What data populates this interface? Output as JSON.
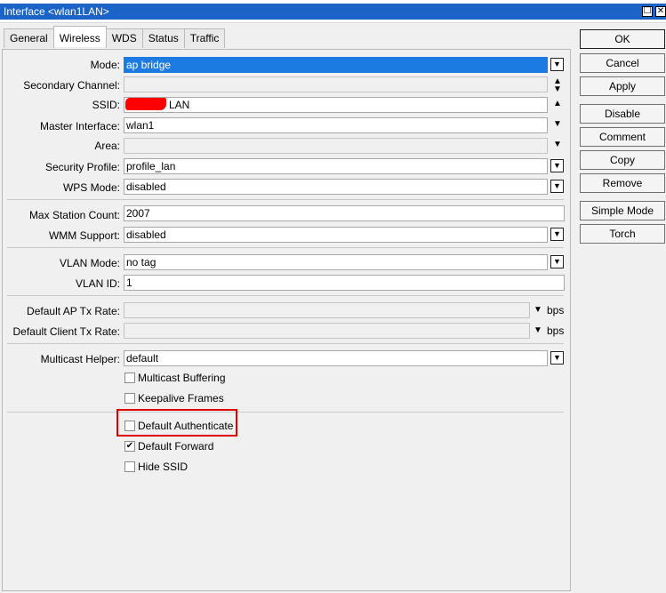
{
  "window": {
    "title": "Interface <wlan1LAN>",
    "maximize_glyph": "☐",
    "close_glyph": "✕"
  },
  "tabs": [
    {
      "label": "General"
    },
    {
      "label": "Wireless"
    },
    {
      "label": "WDS"
    },
    {
      "label": "Status"
    },
    {
      "label": "Traffic"
    }
  ],
  "form": {
    "mode": {
      "label": "Mode:",
      "value": "ap bridge"
    },
    "secondary_channel": {
      "label": "Secondary Channel:",
      "value": ""
    },
    "ssid": {
      "label": "SSID:",
      "value": "LAN"
    },
    "master_interface": {
      "label": "Master Interface:",
      "value": "wlan1"
    },
    "area": {
      "label": "Area:",
      "value": ""
    },
    "security_profile": {
      "label": "Security Profile:",
      "value": "profile_lan"
    },
    "wps_mode": {
      "label": "WPS Mode:",
      "value": "disabled"
    },
    "max_station_count": {
      "label": "Max Station Count:",
      "value": "2007"
    },
    "wmm_support": {
      "label": "WMM Support:",
      "value": "disabled"
    },
    "vlan_mode": {
      "label": "VLAN Mode:",
      "value": "no tag"
    },
    "vlan_id": {
      "label": "VLAN ID:",
      "value": "1"
    },
    "default_ap_tx_rate": {
      "label": "Default AP Tx Rate:",
      "value": "",
      "unit": "bps"
    },
    "default_client_tx_rate": {
      "label": "Default Client Tx Rate:",
      "value": "",
      "unit": "bps"
    },
    "multicast_helper": {
      "label": "Multicast Helper:",
      "value": "default"
    }
  },
  "checkboxes": {
    "multicast_buffering": {
      "label": "Multicast Buffering",
      "checked": false
    },
    "keepalive_frames": {
      "label": "Keepalive Frames",
      "checked": false
    },
    "default_authenticate": {
      "label": "Default Authenticate",
      "checked": false
    },
    "default_forward": {
      "label": "Default Forward",
      "checked": true,
      "mark": "✔"
    },
    "hide_ssid": {
      "label": "Hide SSID",
      "checked": false
    }
  },
  "buttons": {
    "ok": "OK",
    "cancel": "Cancel",
    "apply": "Apply",
    "disable": "Disable",
    "comment": "Comment",
    "copy": "Copy",
    "remove": "Remove",
    "simple_mode": "Simple Mode",
    "torch": "Torch"
  },
  "colors": {
    "title_bar": "#1c63c8",
    "selection": "#1c7ae3",
    "highlight_box": "#e10000"
  }
}
